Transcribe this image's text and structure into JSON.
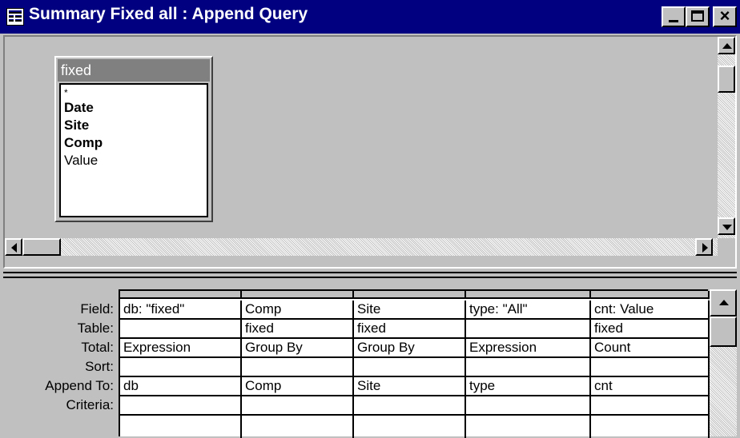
{
  "window": {
    "title": "Summary Fixed all : Append Query"
  },
  "table": {
    "name": "fixed",
    "fields": [
      {
        "label": "*",
        "key": false
      },
      {
        "label": "Date",
        "key": true
      },
      {
        "label": "Site",
        "key": true
      },
      {
        "label": "Comp",
        "key": true
      },
      {
        "label": "Value",
        "key": false
      }
    ]
  },
  "grid": {
    "row_labels": [
      "Field:",
      "Table:",
      "Total:",
      "Sort:",
      "Append To:",
      "Criteria:"
    ],
    "columns": [
      {
        "field": "db: \"fixed\"",
        "table": "",
        "total": "Expression",
        "sort": "",
        "append_to": "db",
        "criteria": ""
      },
      {
        "field": "Comp",
        "table": "fixed",
        "total": "Group By",
        "sort": "",
        "append_to": "Comp",
        "criteria": ""
      },
      {
        "field": "Site",
        "table": "fixed",
        "total": "Group By",
        "sort": "",
        "append_to": "Site",
        "criteria": ""
      },
      {
        "field": "type: \"All\"",
        "table": "",
        "total": "Expression",
        "sort": "",
        "append_to": "type",
        "criteria": ""
      },
      {
        "field": "cnt: Value",
        "table": "fixed",
        "total": "Count",
        "sort": "",
        "append_to": "cnt",
        "criteria": ""
      }
    ]
  },
  "icons": {
    "title": "query-window-icon",
    "minimize": "minimize-icon",
    "maximize": "maximize-icon",
    "close": "close-icon"
  }
}
